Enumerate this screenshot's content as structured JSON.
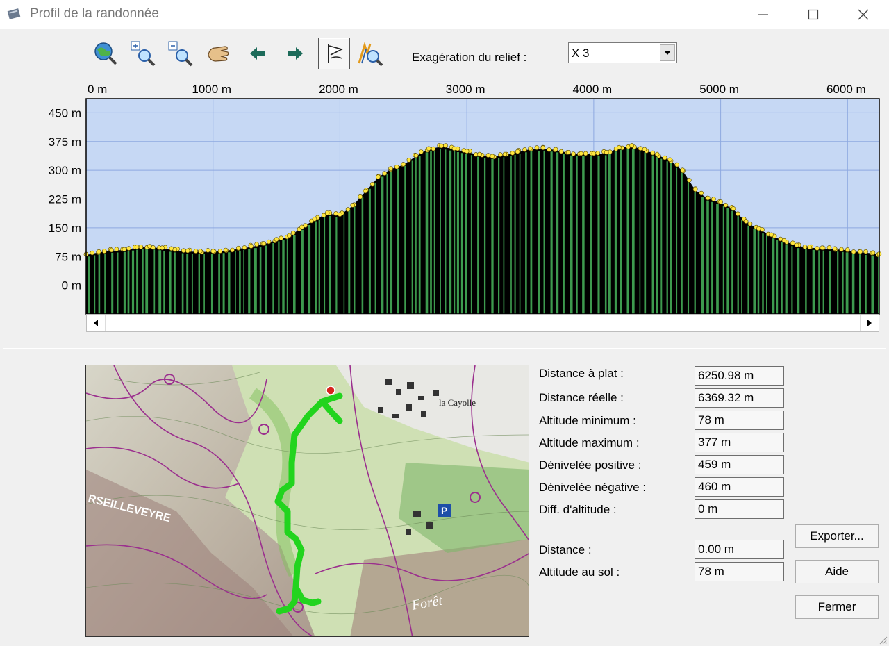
{
  "window": {
    "title": "Profil de la randonnée",
    "icons": [
      "minimize-icon",
      "maximize-icon",
      "close-icon"
    ]
  },
  "toolbar": {
    "tools": [
      "zoom-globe-icon",
      "zoom-in-icon",
      "zoom-out-icon",
      "pan-hand-icon",
      "arrow-left-icon",
      "arrow-right-icon",
      "flag-icon",
      "profile-zoom-icon"
    ],
    "active_tool": "flag-icon",
    "exaggeration_label": "Exagération du relief :",
    "exaggeration_value": "X 3"
  },
  "chart_data": {
    "type": "area",
    "x_ticks": [
      "0 m",
      "1000 m",
      "2000 m",
      "3000 m",
      "4000 m",
      "5000 m",
      "6000 m"
    ],
    "y_ticks": [
      "450 m",
      "375 m",
      "300 m",
      "225 m",
      "150 m",
      "75 m",
      "0 m"
    ],
    "xlim": [
      0,
      6250
    ],
    "ylim": [
      -75,
      487
    ],
    "grid": true,
    "colors": {
      "sky": "#c6d8f4",
      "ground": "#000000",
      "grid": "#8ea9e0",
      "points": "#ffe640",
      "bars": "#3d9a4e"
    },
    "x": [
      0,
      100,
      200,
      300,
      400,
      500,
      600,
      700,
      800,
      900,
      1000,
      1100,
      1200,
      1300,
      1400,
      1500,
      1600,
      1700,
      1800,
      1900,
      2000,
      2100,
      2200,
      2300,
      2400,
      2500,
      2600,
      2700,
      2800,
      2900,
      3000,
      3100,
      3200,
      3300,
      3400,
      3500,
      3600,
      3700,
      3800,
      3900,
      4000,
      4100,
      4200,
      4300,
      4400,
      4500,
      4600,
      4700,
      4800,
      4900,
      5000,
      5100,
      5200,
      5300,
      5400,
      5500,
      5600,
      5700,
      5800,
      5900,
      6000,
      6100,
      6200,
      6250
    ],
    "y": [
      79,
      86,
      90,
      92,
      98,
      100,
      96,
      91,
      88,
      87,
      87,
      90,
      95,
      100,
      107,
      118,
      128,
      150,
      171,
      187,
      183,
      207,
      244,
      281,
      303,
      314,
      337,
      355,
      362,
      355,
      348,
      340,
      335,
      340,
      347,
      355,
      357,
      353,
      345,
      342,
      342,
      345,
      358,
      363,
      353,
      340,
      326,
      299,
      248,
      226,
      216,
      198,
      165,
      146,
      130,
      115,
      103,
      98,
      96,
      94,
      91,
      86,
      83,
      80
    ]
  },
  "stats": [
    {
      "label": "Distance à plat :",
      "value": "6250.98 m"
    },
    {
      "label": "Distance réelle :",
      "value": "6369.32 m"
    },
    {
      "label": "Altitude minimum :",
      "value": "78 m"
    },
    {
      "label": "Altitude maximum :",
      "value": "377 m"
    },
    {
      "label": "Dénivelée positive :",
      "value": "459 m"
    },
    {
      "label": "Dénivelée négative :",
      "value": "460 m"
    },
    {
      "label": "Diff. d'altitude :",
      "value": "0 m"
    },
    {
      "label": "Distance :",
      "value": "0.00 m"
    },
    {
      "label": "Altitude au sol :",
      "value": "78 m"
    }
  ],
  "buttons": {
    "export": "Exporter...",
    "help": "Aide",
    "close": "Fermer"
  },
  "map": {
    "labels": [
      "la Cayolle",
      "RSEILLEVEYRE",
      "Forêt",
      "P"
    ],
    "colors": {
      "track": "#22d41e",
      "roads": "#9b2f8e"
    }
  }
}
